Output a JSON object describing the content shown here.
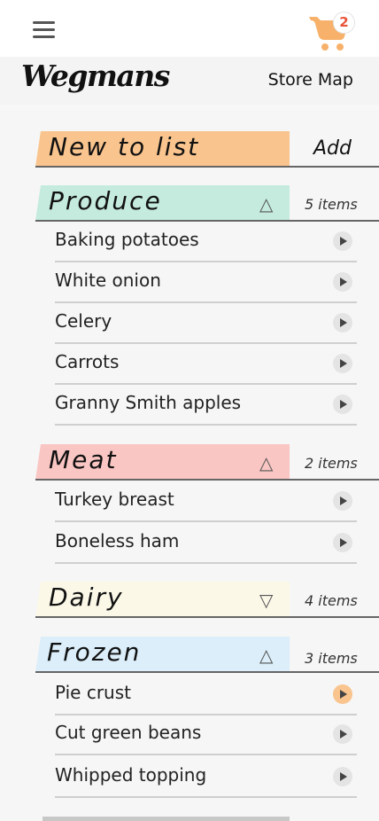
{
  "header": {
    "menu_icon": "hamburger-icon",
    "cart_icon": "shopping-cart-icon",
    "cart_count": "2",
    "cart_color": "#f7b16a"
  },
  "brand": {
    "logo_text": "Wegmans",
    "store_map": "Store Map"
  },
  "new_to_list": {
    "title": "New to list",
    "add_label": "Add",
    "color": "#f9c48d"
  },
  "categories": [
    {
      "name": "Produce",
      "toggle": "△",
      "count": "5 items",
      "color": "#c4ebdd",
      "items": [
        "Baking potatoes",
        "White onion",
        "Celery",
        "Carrots",
        "Granny Smith apples"
      ]
    },
    {
      "name": "Meat",
      "toggle": "△",
      "count": "2 items",
      "color": "#f9c6c3",
      "items": [
        "Turkey breast",
        "Boneless ham"
      ]
    },
    {
      "name": "Dairy",
      "toggle": "▽",
      "count": "4 items",
      "color": "#fbf8e8",
      "items": []
    },
    {
      "name": "Frozen",
      "toggle": "△",
      "count": "3 items",
      "color": "#dbeef9",
      "items": [
        "Pie crust",
        "Cut green beans",
        "Whipped topping"
      ]
    }
  ]
}
